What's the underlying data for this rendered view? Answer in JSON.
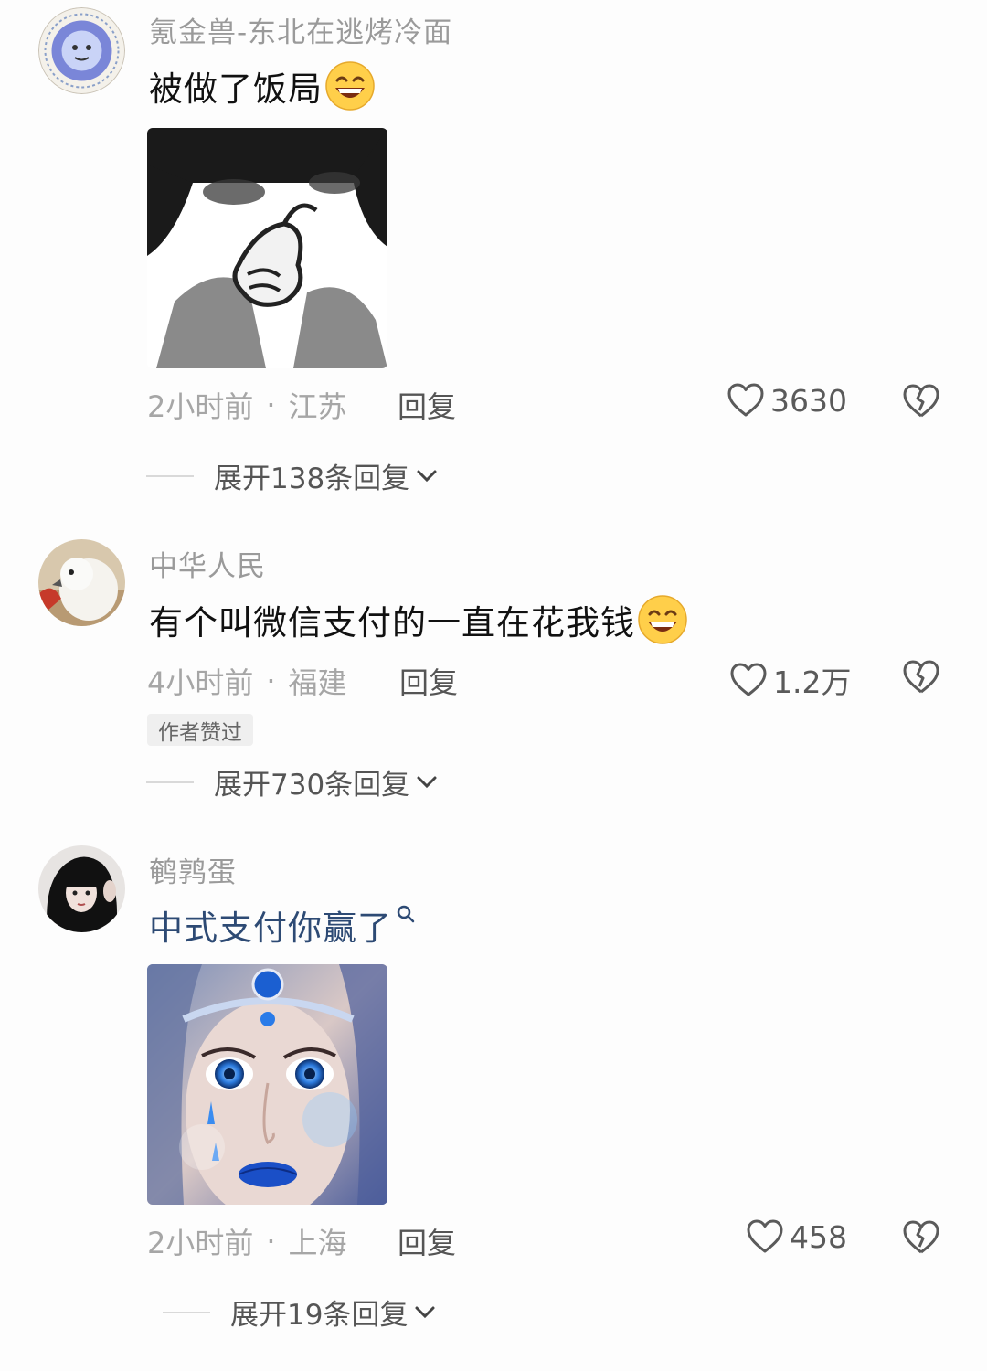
{
  "comments": [
    {
      "username": "氪金兽-东北在逃烤冷面",
      "text": "被做了饭局",
      "emoji": "grin-emoji",
      "time": "2小时前",
      "location": "江苏",
      "reply_label": "回复",
      "likes": "3630",
      "expand_label": "展开138条回复"
    },
    {
      "username": "中华人民",
      "text": "有个叫微信支付的一直在花我钱",
      "emoji": "grin-emoji",
      "time": "4小时前",
      "location": "福建",
      "reply_label": "回复",
      "likes": "1.2万",
      "badge": "作者赞过",
      "expand_label": "展开730条回复"
    },
    {
      "username": "鹌鹑蛋",
      "text": "中式支付你赢了",
      "time": "2小时前",
      "location": "上海",
      "reply_label": "回复",
      "likes": "458",
      "expand_label": "展开19条回复"
    }
  ],
  "separator": "·",
  "colors": {
    "link_text": "#2d4a74",
    "muted": "#a6a6a6"
  }
}
